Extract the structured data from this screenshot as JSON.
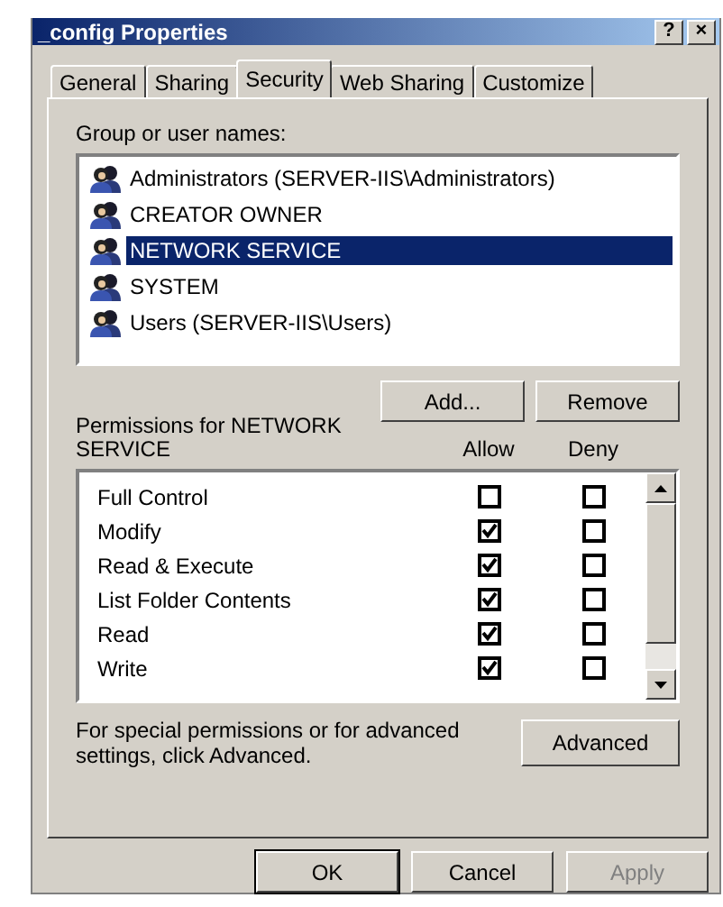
{
  "window": {
    "title": "_config Properties",
    "help_button": "?",
    "close_button": "×"
  },
  "tabs": [
    {
      "label": "General",
      "selected": false
    },
    {
      "label": "Sharing",
      "selected": false
    },
    {
      "label": "Security",
      "selected": true
    },
    {
      "label": "Web Sharing",
      "selected": false
    },
    {
      "label": "Customize",
      "selected": false
    }
  ],
  "group_label": "Group or user names:",
  "users": [
    {
      "name": "Administrators (SERVER-IIS\\Administrators)",
      "selected": false
    },
    {
      "name": "CREATOR OWNER",
      "selected": false
    },
    {
      "name": "NETWORK SERVICE",
      "selected": true
    },
    {
      "name": "SYSTEM",
      "selected": false
    },
    {
      "name": "Users (SERVER-IIS\\Users)",
      "selected": false
    }
  ],
  "user_buttons": [
    {
      "label": "Add...",
      "disabled": false
    },
    {
      "label": "Remove",
      "disabled": false
    }
  ],
  "permissions_label": "Permissions for NETWORK SERVICE",
  "columns": [
    "Allow",
    "Deny"
  ],
  "permissions": [
    {
      "name": "Full Control",
      "allow": false,
      "deny": false
    },
    {
      "name": "Modify",
      "allow": true,
      "deny": false
    },
    {
      "name": "Read & Execute",
      "allow": true,
      "deny": false
    },
    {
      "name": "List Folder Contents",
      "allow": true,
      "deny": false
    },
    {
      "name": "Read",
      "allow": true,
      "deny": false
    },
    {
      "name": "Write",
      "allow": true,
      "deny": false
    }
  ],
  "advanced_note": "For special permissions or for advanced settings, click Advanced.",
  "advanced_button": "Advanced",
  "buttons": [
    {
      "label": "OK",
      "disabled": false,
      "default": true
    },
    {
      "label": "Cancel",
      "disabled": false,
      "default": false
    },
    {
      "label": "Apply",
      "disabled": true,
      "default": false
    }
  ]
}
